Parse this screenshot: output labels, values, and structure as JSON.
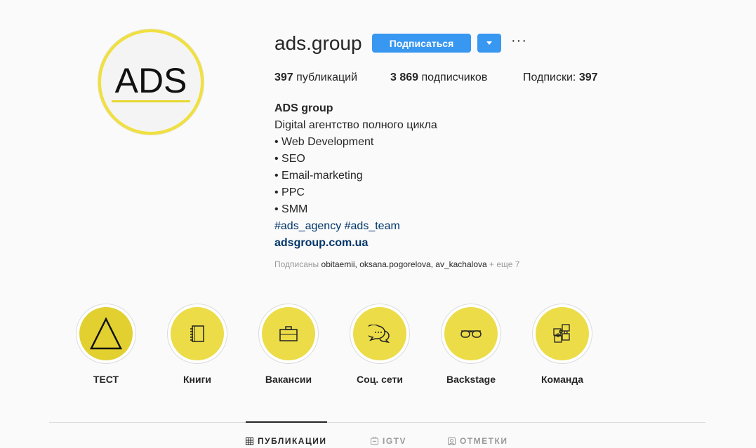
{
  "profile": {
    "avatar_logo": "ADS",
    "username": "ads.group",
    "follow_label": "Подписаться",
    "more_label": "···"
  },
  "stats": {
    "posts_count": "397",
    "posts_label": "публикаций",
    "followers_count": "3 869",
    "followers_label": "подписчиков",
    "following_label": "Подписки:",
    "following_count": "397"
  },
  "bio": {
    "name": "ADS group",
    "lines": [
      "Digital агентство полного цикла",
      "• Web Development",
      "• SEO",
      "• Email-marketing",
      "• PPC",
      "• SMM"
    ],
    "tags": "#ads_agency #ads_team",
    "link": "adsgroup.com.ua"
  },
  "followed_by": {
    "prefix": "Подписаны",
    "users": "obitaemii, oksana.pogorelova, av_kachalova",
    "more": "+ еще 7"
  },
  "highlights": [
    {
      "label": "ТЕСТ",
      "icon": "triangle-icon"
    },
    {
      "label": "Книги",
      "icon": "notebook-icon"
    },
    {
      "label": "Вакансии",
      "icon": "briefcase-icon"
    },
    {
      "label": "Соц. сети",
      "icon": "chat-bubbles-icon"
    },
    {
      "label": "Backstage",
      "icon": "glasses-icon"
    },
    {
      "label": "Команда",
      "icon": "puzzle-icon"
    }
  ],
  "tabs": [
    {
      "label": "ПУБЛИКАЦИИ",
      "icon": "grid-icon",
      "active": true
    },
    {
      "label": "IGTV",
      "icon": "igtv-icon"
    },
    {
      "label": "ОТМЕТКИ",
      "icon": "tagged-icon"
    }
  ],
  "colors": {
    "accent": "#3897f0",
    "highlight": "#ecdc48",
    "avatar_border": "#f0e040"
  }
}
